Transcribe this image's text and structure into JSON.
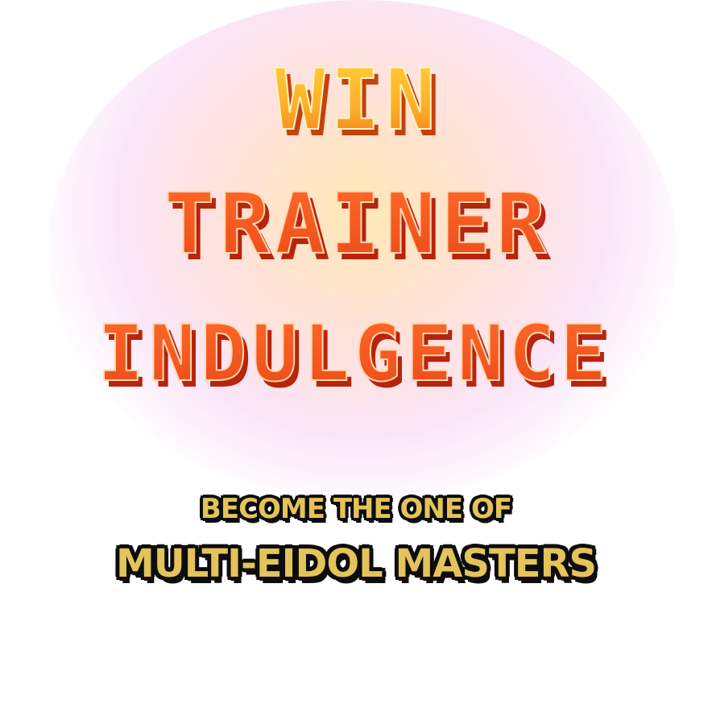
{
  "headline": {
    "line1": "WIN",
    "line2": "TRAINER",
    "line3": "INDULGENCE"
  },
  "tagline": {
    "line1": "BECOME THE ONE OF",
    "line2": "MULTI-EIDOL MASTERS"
  },
  "colors": {
    "line1_top": "#ffd23a",
    "line1_bottom": "#f07a18",
    "headline_fill": "#f25a1e",
    "headline_highlight": "#ffd9b0",
    "headline_shadow": "#b8240c",
    "tagline_fill": "#e3c35a",
    "tagline_outline": "#0d0d0d"
  }
}
